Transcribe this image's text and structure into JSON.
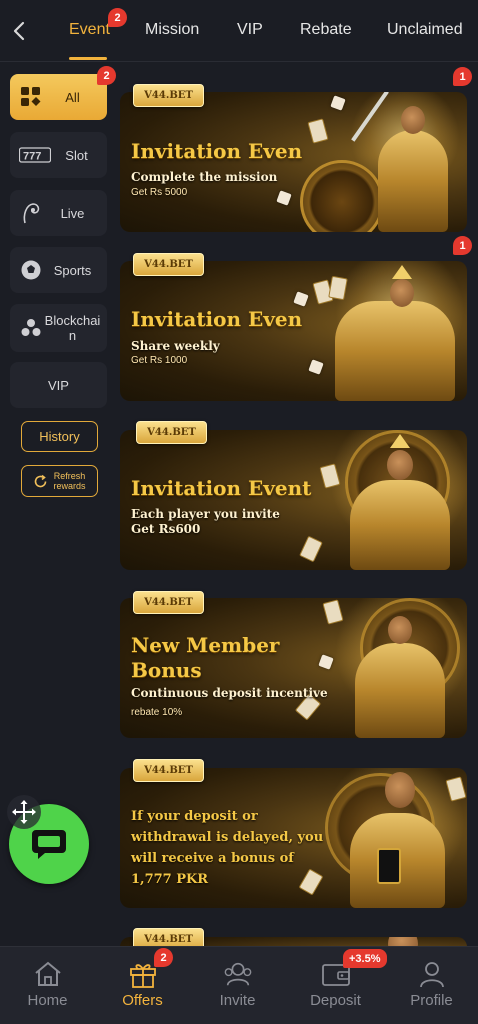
{
  "tabs": [
    {
      "label": "Event",
      "active": true,
      "badge": "2"
    },
    {
      "label": "Mission"
    },
    {
      "label": "VIP"
    },
    {
      "label": "Rebate"
    },
    {
      "label": "Unclaimed"
    }
  ],
  "sidebar": {
    "items": [
      {
        "label": "All",
        "icon": "grid-icon",
        "active": true,
        "badge": "2"
      },
      {
        "label": "Slot",
        "icon": "slot-777-icon"
      },
      {
        "label": "Live",
        "icon": "live-dealer-icon"
      },
      {
        "label": "Sports",
        "icon": "soccer-ball-icon"
      },
      {
        "label": "Blockchai\nn",
        "icon": "blockchain-icon"
      },
      {
        "label": "VIP"
      }
    ],
    "history_label": "History",
    "refresh_label": "Refresh\nrewards"
  },
  "banners": [
    {
      "brand": "V44.BET",
      "title": "Invitation Even",
      "subtitle": "Complete the mission",
      "detail": "Get Rs 5000",
      "badge": "1"
    },
    {
      "brand": "V44.BET",
      "title": "Invitation Even",
      "subtitle": "Share weekly",
      "detail": "Get Rs 1000",
      "badge": "1"
    },
    {
      "brand": "V44.BET",
      "title": "Invitation Event",
      "subtitle": "Each player you invite",
      "detail": "Get Rs600"
    },
    {
      "brand": "V44.BET",
      "title": "New Member Bonus",
      "subtitle": "Continuous deposit incentive",
      "detail": "rebate 10%"
    },
    {
      "brand": "V44.BET",
      "text": "If your deposit or withdrawal is delayed, you will receive a bonus of 1,777 PKR"
    },
    {
      "brand": "V44.BET"
    }
  ],
  "bottom_nav": [
    {
      "label": "Home",
      "icon": "home-icon"
    },
    {
      "label": "Offers",
      "icon": "gift-icon",
      "active": true,
      "badge": "2"
    },
    {
      "label": "Invite",
      "icon": "invite-icon"
    },
    {
      "label": "Deposit",
      "icon": "wallet-icon",
      "badge": "+3.5%"
    },
    {
      "label": "Profile",
      "icon": "profile-icon"
    }
  ],
  "colors": {
    "accent": "#f2b33d",
    "badge": "#e5392e",
    "background": "#1b1d24",
    "chat": "#4fd34a"
  }
}
